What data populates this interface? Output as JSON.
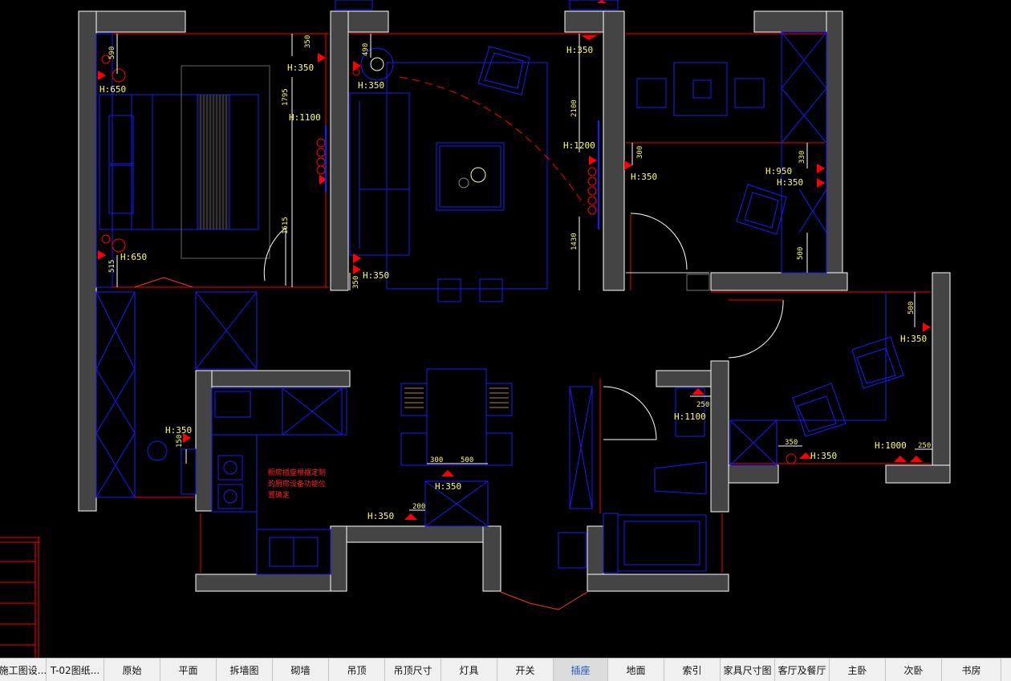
{
  "colors": {
    "wall": "#444444",
    "wall_edge": "#ffffff",
    "furniture": "#1a1aff",
    "red": "#ff0000",
    "text": "#ffff66",
    "bg": "#000000"
  },
  "annotations": {
    "h650a": "H:650",
    "h650b": "H:650",
    "h350_bed": "H:350",
    "h1100_bed": "H:1100",
    "h350_sofa": "H:350",
    "h350_sofa_low": "H:350",
    "h350_top": "H:350",
    "h1200": "H:1200",
    "h350_rt": "H:350",
    "h950": "H:950",
    "h350_rt2": "H:350",
    "h350_bal": "H:350",
    "h350_kit": "H:350",
    "h1100_bath": "H:1100",
    "h350_din": "H:350",
    "h350_din2": "H:350",
    "h1000": "H:1000",
    "h350_study": "H:350"
  },
  "dimensions": {
    "d590": "590",
    "d350a": "350",
    "d1795": "1795",
    "d1615": "1615",
    "d515": "515",
    "d490": "490",
    "d350b": "350",
    "d2100": "2100",
    "d1430": "1430",
    "d300a": "300",
    "d330": "330",
    "d500a": "500",
    "d500b": "500",
    "d150": "150",
    "d250a": "250",
    "d300b": "300",
    "d500c": "500",
    "d200": "200",
    "d350c": "350",
    "d250b": "250"
  },
  "kitchen_note": [
    "橱房插座根据定制",
    "的厨房设备功能位",
    "置确定"
  ],
  "tabs": [
    {
      "label": "施工图设...",
      "active": false
    },
    {
      "label": "T-02图纸...",
      "active": false
    },
    {
      "label": "原始",
      "active": false
    },
    {
      "label": "平面",
      "active": false
    },
    {
      "label": "拆墙图",
      "active": false
    },
    {
      "label": "砌墙",
      "active": false
    },
    {
      "label": "吊顶",
      "active": false
    },
    {
      "label": "吊顶尺寸",
      "active": false
    },
    {
      "label": "灯具",
      "active": false
    },
    {
      "label": "开关",
      "active": false
    },
    {
      "label": "插座",
      "active": true
    },
    {
      "label": "地面",
      "active": false
    },
    {
      "label": "索引",
      "active": false
    },
    {
      "label": "家具尺寸图",
      "active": false
    },
    {
      "label": "客厅及餐厅",
      "active": false
    },
    {
      "label": "主卧",
      "active": false
    },
    {
      "label": "次卧",
      "active": false
    },
    {
      "label": "书房",
      "active": false
    }
  ]
}
